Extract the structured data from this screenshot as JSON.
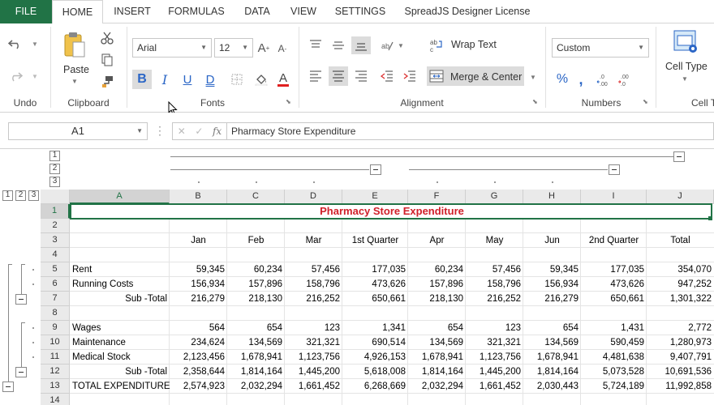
{
  "tabs": {
    "file": "FILE",
    "home": "HOME",
    "insert": "INSERT",
    "formulas": "FORMULAS",
    "data": "DATA",
    "view": "VIEW",
    "settings": "SETTINGS",
    "license": "SpreadJS Designer License"
  },
  "ribbon": {
    "undo_group": "Undo",
    "clipboard_group": "Clipboard",
    "paste_label": "Paste",
    "fonts_group": "Fonts",
    "font_family": "Arial",
    "font_size": "12",
    "bold": "B",
    "italic": "I",
    "underline": "U",
    "double_underline": "D",
    "alignment_group": "Alignment",
    "wrap_text": "Wrap Text",
    "merge_center": "Merge & Center",
    "numbers_group": "Numbers",
    "number_format": "Custom",
    "cell_type": "Cell Type",
    "cell_group": "Cell T"
  },
  "formula_bar": {
    "name_box": "A1",
    "formula": "Pharmacy Store Expenditure"
  },
  "sheet": {
    "outline_col_levels": [
      "1",
      "2",
      "3"
    ],
    "outline_row_levels": [
      "1",
      "2",
      "3"
    ],
    "columns": [
      "A",
      "B",
      "C",
      "D",
      "E",
      "F",
      "G",
      "H",
      "I",
      "J"
    ],
    "rows": [
      "1",
      "2",
      "3",
      "4",
      "5",
      "6",
      "7",
      "8",
      "9",
      "10",
      "11",
      "12",
      "13",
      "14"
    ],
    "title": "Pharmacy Store Expenditure",
    "header_row": [
      "Jan",
      "Feb",
      "Mar",
      "1st Quarter",
      "Apr",
      "May",
      "Jun",
      "2nd Quarter",
      "Total"
    ],
    "data_rows": [
      {
        "label": "Rent",
        "values": [
          "59,345",
          "60,234",
          "57,456",
          "177,035",
          "60,234",
          "57,456",
          "59,345",
          "177,035",
          "354,070"
        ]
      },
      {
        "label": "Running Costs",
        "values": [
          "156,934",
          "157,896",
          "158,796",
          "473,626",
          "157,896",
          "158,796",
          "156,934",
          "473,626",
          "947,252"
        ]
      },
      {
        "label": "Sub -Total",
        "values": [
          "216,279",
          "218,130",
          "216,252",
          "650,661",
          "218,130",
          "216,252",
          "216,279",
          "650,661",
          "1,301,322"
        ]
      },
      {
        "label": "",
        "values": [
          "",
          "",
          "",
          "",
          "",
          "",
          "",
          "",
          ""
        ]
      },
      {
        "label": "Wages",
        "values": [
          "564",
          "654",
          "123",
          "1,341",
          "654",
          "123",
          "654",
          "1,431",
          "2,772"
        ]
      },
      {
        "label": "Maintenance",
        "values": [
          "234,624",
          "134,569",
          "321,321",
          "690,514",
          "134,569",
          "321,321",
          "134,569",
          "590,459",
          "1,280,973"
        ]
      },
      {
        "label": "Medical Stock",
        "values": [
          "2,123,456",
          "1,678,941",
          "1,123,756",
          "4,926,153",
          "1,678,941",
          "1,123,756",
          "1,678,941",
          "4,481,638",
          "9,407,791"
        ]
      },
      {
        "label": "Sub -Total",
        "values": [
          "2,358,644",
          "1,814,164",
          "1,445,200",
          "5,618,008",
          "1,814,164",
          "1,445,200",
          "1,814,164",
          "5,073,528",
          "10,691,536"
        ]
      },
      {
        "label": "TOTAL EXPENDITURE",
        "values": [
          "2,574,923",
          "2,032,294",
          "1,661,452",
          "6,268,669",
          "2,032,294",
          "1,661,452",
          "2,030,443",
          "5,724,189",
          "11,992,858"
        ]
      }
    ]
  },
  "colors": {
    "accent": "#217346",
    "title_text": "#d0202a",
    "bold_active": "#2b66c6"
  }
}
